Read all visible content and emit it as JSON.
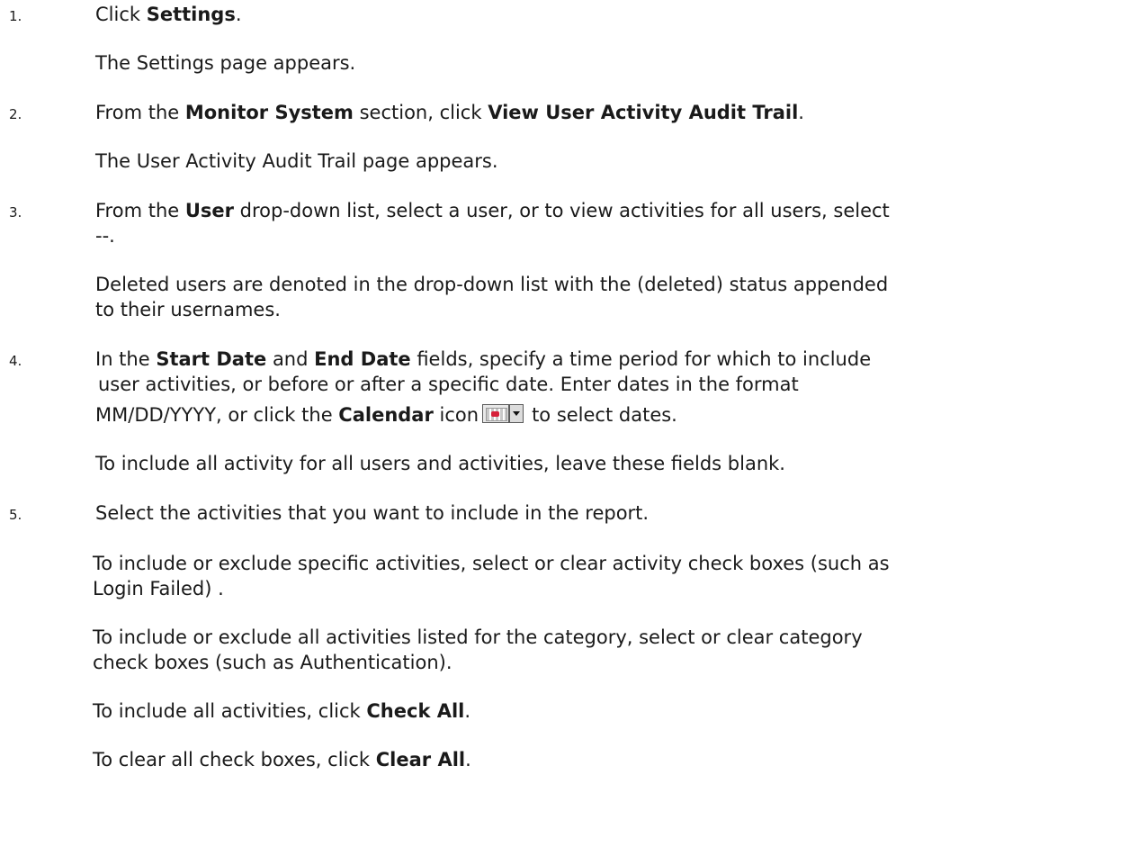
{
  "steps": [
    {
      "number": "1.",
      "main": {
        "pre": "Click ",
        "bold": "Settings",
        "post": "."
      },
      "result": "The Settings page appears."
    },
    {
      "number": "2.",
      "main": {
        "pre": "From the ",
        "bold1": "Monitor System",
        "mid": " section, click ",
        "bold2": "View User Activity Audit Trail",
        "post": "."
      },
      "result": "The User Activity Audit Trail page appears."
    },
    {
      "number": "3.",
      "main": {
        "pre": "From the ",
        "bold": "User",
        "post_line1": " drop-down list, select a user, or to view activities for all users, select",
        "line2": "--."
      },
      "note_line1": "Deleted users are denoted in the drop-down list with the (deleted) status appended",
      "note_line2": "to their usernames."
    },
    {
      "number": "4.",
      "main": {
        "pre": "In the ",
        "bold1": "Start Date",
        "mid": " and ",
        "bold2": "End Date",
        "post_line1": " fields, specify a time period for which to include",
        "line2": "user activities, or before or after a specific date. Enter dates in the format",
        "line3_pre": "MM/DD/YYYY, or click the ",
        "line3_bold": "Calendar",
        "line3_mid": " icon",
        "line3_post": "to select dates."
      },
      "icon": "calendar-dropdown-icon",
      "note": "To include all activity for all users and activities, leave these fields blank."
    },
    {
      "number": "5.",
      "main": "Select the activities that you want to include in the report.",
      "sub1_line1": "To include or exclude specific activities, select or clear activity check boxes (such as",
      "sub1_line2": "Login Failed) .",
      "sub2_line1": "To include or exclude all activities listed for the category, select or clear category",
      "sub2_line2": "check boxes (such as Authentication).",
      "sub3": {
        "pre": "To include all activities, click ",
        "bold": "Check All",
        "post": "."
      },
      "sub4": {
        "pre": "To clear all check boxes, click ",
        "bold": "Clear All",
        "post": "."
      }
    }
  ]
}
